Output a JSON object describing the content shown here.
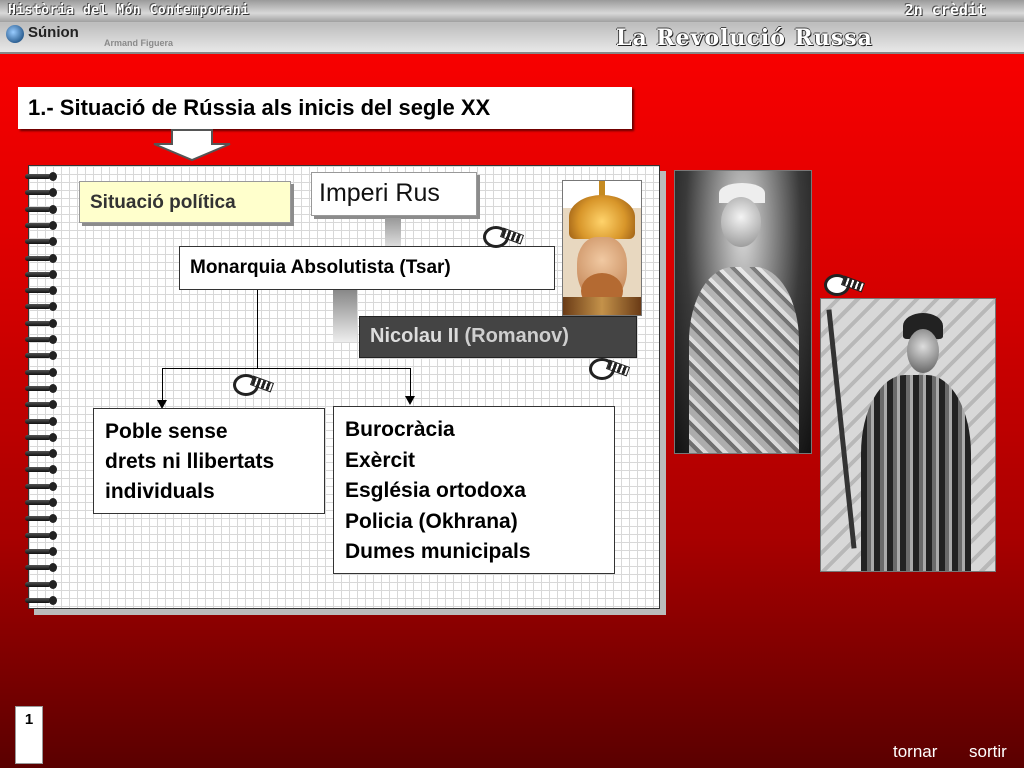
{
  "header": {
    "course_title": "Història del Món Contemporani",
    "credit": "2n crèdit",
    "logo_text": "Súnion",
    "author": "Armand Figuera",
    "topic": "La Revolució Russa"
  },
  "slide": {
    "title": "1.- Situació de Rússia als inicis del segle XX",
    "situacio_politica": "Situació política",
    "imperi": "Imperi Rus",
    "monarquia": "Monarquia Absolutista (Tsar)",
    "tsar_name": "Nicolau II",
    "tsar_dynasty": "(Romanov)",
    "poble": "Poble sense\ndrets ni llibertats\nindividuals",
    "institutions": [
      "Burocràcia",
      "Exèrcit",
      "Església ortodoxa",
      "Policia (Okhrana)",
      "Dumes municipals"
    ]
  },
  "icons": {
    "film": "film-reel-icon",
    "down_arrow": "down-arrow-icon"
  },
  "footer": {
    "page_number": "1",
    "tornar": "tornar",
    "sortir": "sortir"
  },
  "colors": {
    "background_top": "#ff0000",
    "background_bottom": "#5a0000",
    "highlight_box": "#ffffcc",
    "tsar_box": "#444444"
  }
}
